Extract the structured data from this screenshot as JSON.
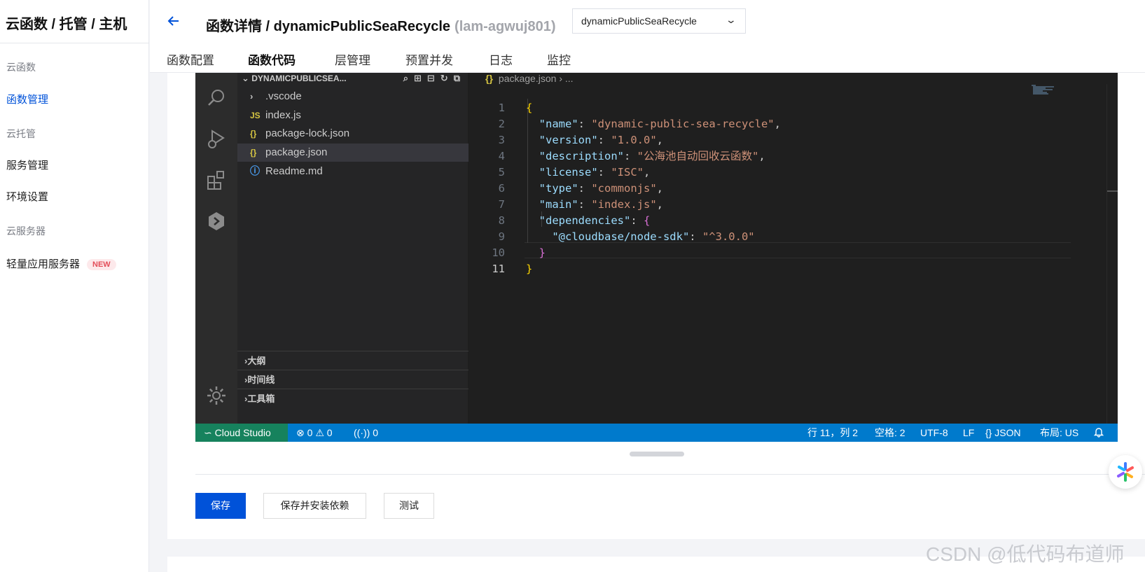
{
  "sidebar": {
    "title": "云函数 / 托管 / 主机",
    "sections": [
      {
        "label": "云函数"
      },
      {
        "label": "云托管"
      },
      {
        "label": "云服务器"
      }
    ],
    "items": [
      {
        "label": "函数管理",
        "active": true
      },
      {
        "label": "服务管理"
      },
      {
        "label": "环境设置"
      },
      {
        "label": "轻量应用服务器",
        "badge": "NEW"
      }
    ]
  },
  "header": {
    "back_icon": "arrow-left-icon",
    "title": "函数详情 / dynamicPublicSeaRecycle",
    "function_id": "(lam-agwuj801)",
    "function_select": "dynamicPublicSeaRecycle",
    "tabs": [
      {
        "label": "函数配置"
      },
      {
        "label": "函数代码",
        "active": true
      },
      {
        "label": "层管理"
      },
      {
        "label": "预置并发"
      },
      {
        "label": "日志"
      },
      {
        "label": "监控"
      }
    ]
  },
  "explorer": {
    "root": "DYNAMICPUBLICSEA...",
    "files": [
      {
        "icon": "chevron-right-icon",
        "label": ".vscode"
      },
      {
        "icon": "js-file-icon",
        "icon_text": "JS",
        "label": "index.js"
      },
      {
        "icon": "json-file-icon",
        "icon_text": "{}",
        "label": "package-lock.json"
      },
      {
        "icon": "json-file-icon",
        "icon_text": "{}",
        "label": "package.json",
        "selected": true
      },
      {
        "icon": "info-icon",
        "icon_text": "ⓘ",
        "label": "Readme.md"
      }
    ],
    "panels": [
      "大纲",
      "时间线",
      "工具箱"
    ]
  },
  "editor": {
    "breadcrumb_file": "package.json",
    "breadcrumb_tail": "› ...",
    "line_numbers": [
      "1",
      "2",
      "3",
      "4",
      "5",
      "6",
      "7",
      "8",
      "9",
      "10",
      "11"
    ],
    "current_line": 11,
    "code": {
      "name_key": "\"name\"",
      "name_val": "\"dynamic-public-sea-recycle\"",
      "version_key": "\"version\"",
      "version_val": "\"1.0.0\"",
      "description_key": "\"description\"",
      "description_val": "\"公海池自动回收云函数\"",
      "license_key": "\"license\"",
      "license_val": "\"ISC\"",
      "type_key": "\"type\"",
      "type_val": "\"commonjs\"",
      "main_key": "\"main\"",
      "main_val": "\"index.js\"",
      "deps_key": "\"dependencies\"",
      "sdk_key": "\"@cloudbase/node-sdk\"",
      "sdk_val": "\"^3.0.0\""
    }
  },
  "statusbar": {
    "brand": "Cloud Studio",
    "errors": "0",
    "warnings": "0",
    "ports": "0",
    "position": "行 11，列 2",
    "spaces": "空格: 2",
    "encoding": "UTF-8",
    "eol": "LF",
    "language": "{} JSON",
    "layout": "布局: US"
  },
  "actions": {
    "save": "保存",
    "save_install": "保存并安装依赖",
    "test": "测试"
  },
  "watermark": "CSDN @低代码布道师"
}
